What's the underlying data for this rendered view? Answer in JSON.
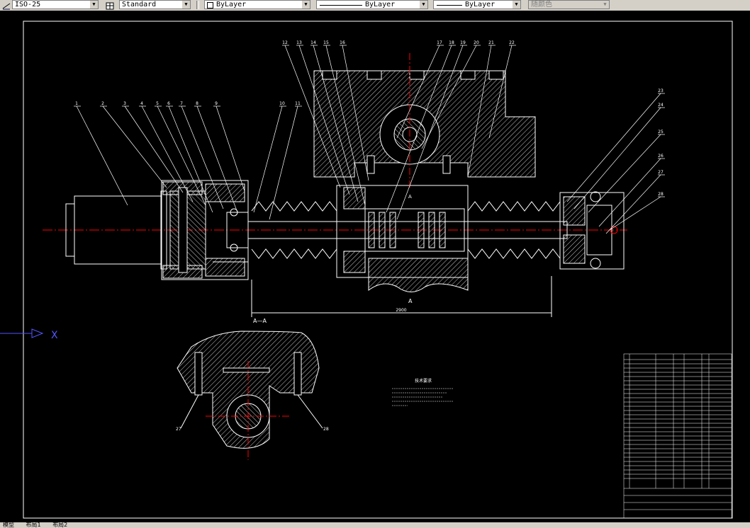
{
  "toolbar": {
    "dimstyle": "ISO-25",
    "tablestyle": "Standard",
    "layer": "ByLayer",
    "linetype": "ByLayer",
    "lineweight": "ByLayer",
    "color": "随颜色"
  },
  "drawing": {
    "balloons": [
      "1",
      "2",
      "3",
      "4",
      "5",
      "6",
      "7",
      "8",
      "9",
      "10",
      "11",
      "12",
      "13",
      "14",
      "15",
      "16",
      "17",
      "18",
      "19",
      "20",
      "21",
      "22",
      "23",
      "24",
      "25",
      "26",
      "27",
      "28"
    ],
    "section_label": "A",
    "section_title": "A—A",
    "dimension": "2900",
    "bottom_balloon_left": "27",
    "bottom_balloon_right": "28",
    "ucs_x": "X",
    "tech_title": "技术要求"
  },
  "statusbar": {
    "tabs": [
      "模型",
      "布局1",
      "布局2"
    ]
  }
}
